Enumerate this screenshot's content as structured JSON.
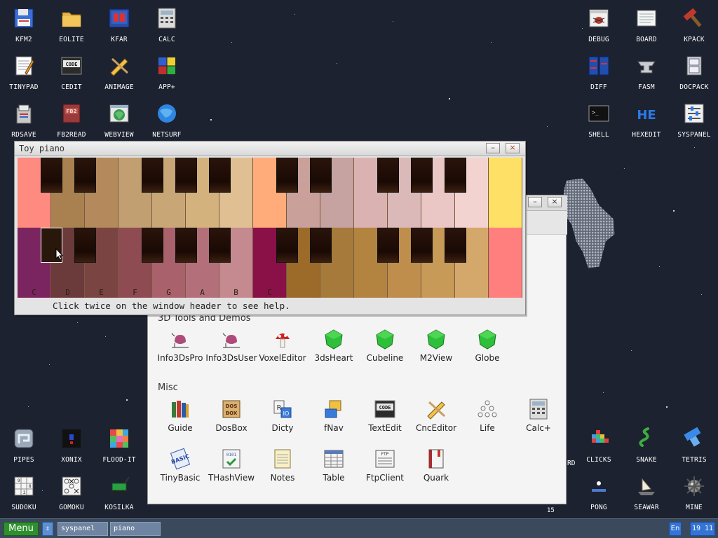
{
  "desktop": {
    "icons_left": [
      {
        "label": "KFM2",
        "icon": "floppy-icon"
      },
      {
        "label": "EOLITE",
        "icon": "folder-icon"
      },
      {
        "label": "KFAR",
        "icon": "kfar-icon"
      },
      {
        "label": "CALC",
        "icon": "calculator-icon"
      },
      {
        "label": "TINYPAD",
        "icon": "notepad-icon"
      },
      {
        "label": "CEDIT",
        "icon": "code-icon"
      },
      {
        "label": "ANIMAGE",
        "icon": "pencil-icon"
      },
      {
        "label": "APP+",
        "icon": "cube-icon"
      },
      {
        "label": "RDSAVE",
        "icon": "disk-save-icon"
      },
      {
        "label": "FB2READ",
        "icon": "book-icon"
      },
      {
        "label": "WEBVIEW",
        "icon": "globe-window-icon"
      },
      {
        "label": "NETSURF",
        "icon": "globe-icon"
      }
    ],
    "icons_right": [
      {
        "label": "DEBUG",
        "icon": "bug-icon"
      },
      {
        "label": "BOARD",
        "icon": "board-icon"
      },
      {
        "label": "KPACK",
        "icon": "hammer-icon"
      },
      {
        "label": "DIFF",
        "icon": "diff-icon"
      },
      {
        "label": "FASM",
        "icon": "anvil-icon"
      },
      {
        "label": "DOCPACK",
        "icon": "cabinet-icon"
      },
      {
        "label": "SHELL",
        "icon": "terminal-icon"
      },
      {
        "label": "HEXEDIT",
        "icon": "hex-icon"
      },
      {
        "label": "SYSPANEL",
        "icon": "sliders-icon"
      }
    ],
    "icons_bottom_left": [
      {
        "label": "PIPES",
        "icon": "pipes-icon"
      },
      {
        "label": "XONIX",
        "icon": "xonix-icon"
      },
      {
        "label": "FLOOD-IT",
        "icon": "flood-icon"
      },
      {
        "label": "SUDOKU",
        "icon": "sudoku-icon"
      },
      {
        "label": "GOMOKU",
        "icon": "gomoku-icon"
      },
      {
        "label": "KOSILKA",
        "icon": "mower-icon"
      }
    ],
    "icons_bottom_right": [
      {
        "label": "CLICKS",
        "icon": "clicks-icon"
      },
      {
        "label": "SNAKE",
        "icon": "snake-icon"
      },
      {
        "label": "TETRIS",
        "icon": "tetris-icon"
      },
      {
        "label": "PONG",
        "icon": "pong-icon"
      },
      {
        "label": "SEAWAR",
        "icon": "ship-icon"
      },
      {
        "label": "MINE",
        "icon": "mine-icon"
      }
    ],
    "partial_label": "RD",
    "counter": "15"
  },
  "launcher": {
    "section_3d": "3D Tools and Demos",
    "apps_3d": [
      "Info3DsPro",
      "Info3DsUser",
      "VoxelEditor",
      "3dsHeart",
      "Cubeline",
      "M2View",
      "Globe"
    ],
    "section_misc": "Misc",
    "apps_misc_row1": [
      "Guide",
      "DosBox",
      "Dicty",
      "fNav",
      "TextEdit",
      "CncEditor",
      "Life",
      "Calc+"
    ],
    "apps_misc_row2": [
      "TinyBasic",
      "THashView",
      "Notes",
      "Table",
      "FtpClient",
      "Quark"
    ]
  },
  "piano": {
    "title": "Toy piano",
    "minimize": "–",
    "close": "×",
    "notes": [
      "C",
      "D",
      "E",
      "F",
      "G",
      "A",
      "B",
      "C"
    ],
    "hint": "Click twice on the window header to see help.",
    "top_colors": [
      "#ff8a80",
      "#a98150",
      "#b48a5c",
      "#c29f70",
      "#c9a676",
      "#d4b27e",
      "#e0c092",
      "#ffab7a",
      "#c9a09a",
      "#c6a3a0",
      "#dbb2b2",
      "#dbb9b8",
      "#eac7c5",
      "#f2d3d0",
      "#ffe066"
    ],
    "bottom_colors": [
      "#7b2560",
      "#6b3a3a",
      "#7a4443",
      "#8e4b52",
      "#a9616c",
      "#b4707a",
      "#c48a8f",
      "#8a1048",
      "#9c6b2a",
      "#a67a3a",
      "#b28440",
      "#c08e4c",
      "#c89a58",
      "#d4a86a",
      "#ff7f7f"
    ]
  },
  "taskbar": {
    "menu": "Menu",
    "arrow": "⇕",
    "tasks": [
      "syspanel",
      "piano"
    ],
    "lang": "En",
    "clock": "19 11"
  }
}
